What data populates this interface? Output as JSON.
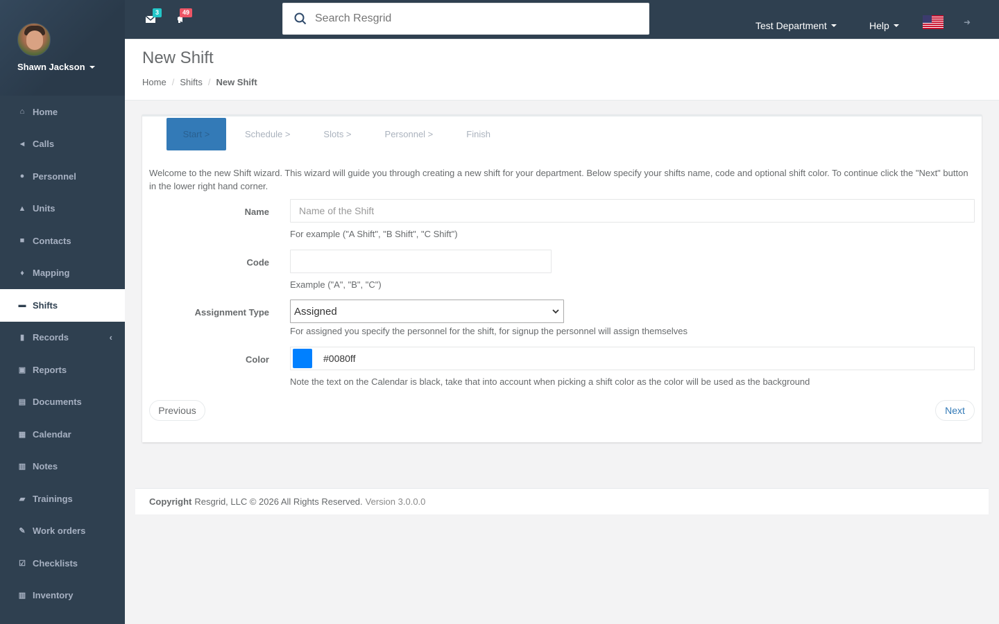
{
  "profile": {
    "name": "Shawn Jackson"
  },
  "sidebar": {
    "items": [
      {
        "label": "Home",
        "icon": "home-icon"
      },
      {
        "label": "Calls",
        "icon": "bullhorn-icon"
      },
      {
        "label": "Personnel",
        "icon": "user-icon"
      },
      {
        "label": "Units",
        "icon": "truck-icon"
      },
      {
        "label": "Contacts",
        "icon": "address-book-icon"
      },
      {
        "label": "Mapping",
        "icon": "map-marker-icon"
      },
      {
        "label": "Shifts",
        "icon": "briefcase-icon",
        "active": true
      },
      {
        "label": "Records",
        "icon": "file-icon"
      },
      {
        "label": "Reports",
        "icon": "reports-icon"
      },
      {
        "label": "Documents",
        "icon": "documents-icon"
      },
      {
        "label": "Calendar",
        "icon": "calendar-icon"
      },
      {
        "label": "Notes",
        "icon": "notes-icon"
      },
      {
        "label": "Trainings",
        "icon": "book-icon"
      },
      {
        "label": "Work orders",
        "icon": "wrench-icon"
      },
      {
        "label": "Checklists",
        "icon": "checklist-icon"
      },
      {
        "label": "Inventory",
        "icon": "barcode-icon"
      }
    ]
  },
  "topbar": {
    "messages_count": "3",
    "calls_count": "49",
    "search_placeholder": "Search Resgrid",
    "department": "Test Department",
    "help": "Help"
  },
  "heading": {
    "title": "New Shift",
    "breadcrumb": [
      "Home",
      "Shifts",
      "New Shift"
    ]
  },
  "wizard": {
    "steps": [
      "Start >",
      "Schedule >",
      "Slots >",
      "Personnel >",
      "Finish"
    ],
    "intro": "Welcome to the new Shift wizard. This wizard will guide you through creating a new shift for your department. Below specify your shifts name, code and optional shift color. To continue click the \"Next\" button in the lower right hand corner.",
    "name_label": "Name",
    "name_placeholder": "Name of the Shift",
    "name_help": "For example (\"A Shift\", \"B Shift\", \"C Shift\")",
    "code_label": "Code",
    "code_value": "",
    "code_help": "Example (\"A\", \"B\", \"C\")",
    "assignment_label": "Assignment Type",
    "assignment_value": "Assigned",
    "assignment_help": "For assigned you specify the personnel for the shift, for signup the personnel will assign themselves",
    "color_label": "Color",
    "color_value": "#0080ff",
    "color_help": "Note the text on the Calendar is black, take that into account when picking a shift color as the color will be used as the background",
    "previous": "Previous",
    "next": "Next"
  },
  "footer": {
    "copyright": "Copyright",
    "text": "Resgrid, LLC © 2026 All Rights Reserved.",
    "version": "Version 3.0.0.0"
  },
  "colors": {
    "sidebar": "#2f4050",
    "primary": "#337ab7",
    "shift_color": "#0080ff"
  }
}
